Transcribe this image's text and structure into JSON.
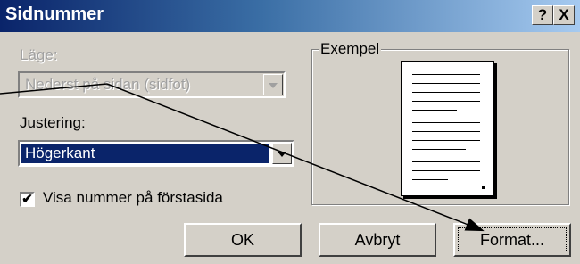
{
  "window": {
    "title": "Sidnummer",
    "help_glyph": "?",
    "close_glyph": "X"
  },
  "position": {
    "label": "Läge:",
    "value": "Nederst på sidan (sidfot)"
  },
  "alignment": {
    "label": "Justering:",
    "value": "Högerkant"
  },
  "first_page": {
    "checked_glyph": "✔",
    "label": "Visa nummer på förstasida",
    "checked": true
  },
  "preview": {
    "label": "Exempel"
  },
  "buttons": {
    "ok": "OK",
    "cancel": "Avbryt",
    "format": "Format..."
  },
  "annotation": {
    "color": "#000000"
  }
}
